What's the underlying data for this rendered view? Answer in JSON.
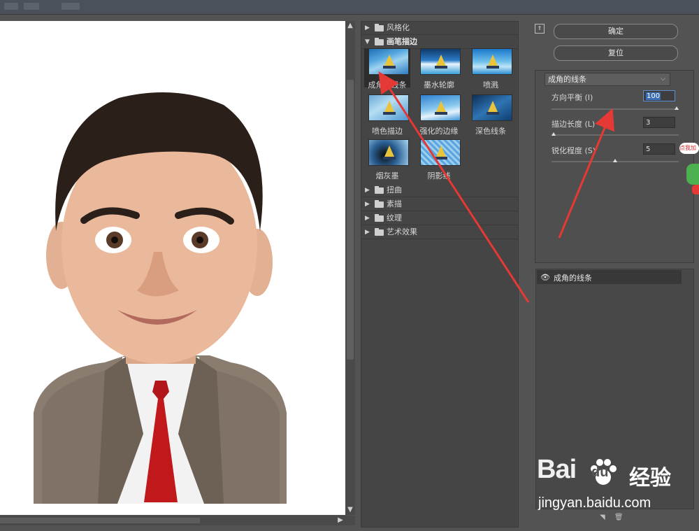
{
  "titlebar": {
    "blurred_items": [
      "",
      "",
      ""
    ]
  },
  "filter_gallery": {
    "categories": [
      {
        "label": "风格化",
        "open": false
      },
      {
        "label": "画笔描边",
        "open": true
      },
      {
        "label": "扭曲",
        "open": false
      },
      {
        "label": "素描",
        "open": false
      },
      {
        "label": "纹理",
        "open": false
      },
      {
        "label": "艺术效果",
        "open": false
      }
    ],
    "brush_filters": [
      {
        "label": "成角的线条",
        "selected": true
      },
      {
        "label": "墨水轮廓",
        "selected": false
      },
      {
        "label": "喷溅",
        "selected": false
      },
      {
        "label": "喷色描边",
        "selected": false
      },
      {
        "label": "强化的边缘",
        "selected": false
      },
      {
        "label": "深色线条",
        "selected": false
      },
      {
        "label": "烟灰墨",
        "selected": false
      },
      {
        "label": "阴影线",
        "selected": false
      }
    ]
  },
  "buttons": {
    "ok": "确定",
    "reset": "复位"
  },
  "settings": {
    "filter_select": "成角的线条",
    "params": [
      {
        "label": "方向平衡 (I)",
        "value": "100",
        "level": 1.0
      },
      {
        "label": "描边长度 (L)",
        "value": "3",
        "level": 0.0
      },
      {
        "label": "锐化程度 (S)",
        "value": "5",
        "level": 0.5
      }
    ]
  },
  "layers": {
    "items": [
      {
        "label": "成角的线条",
        "visible": true
      }
    ]
  },
  "watermark": {
    "brand": "Bai",
    "brand2": "du",
    "cn": "经验",
    "url": "jingyan.baidu.com"
  },
  "sticker": {
    "text": "点我加"
  },
  "colors": {
    "panel_bg": "#535353",
    "list_bg": "#454545",
    "annotation_arrow": "#e53935",
    "tie_red": "#c0181b"
  }
}
